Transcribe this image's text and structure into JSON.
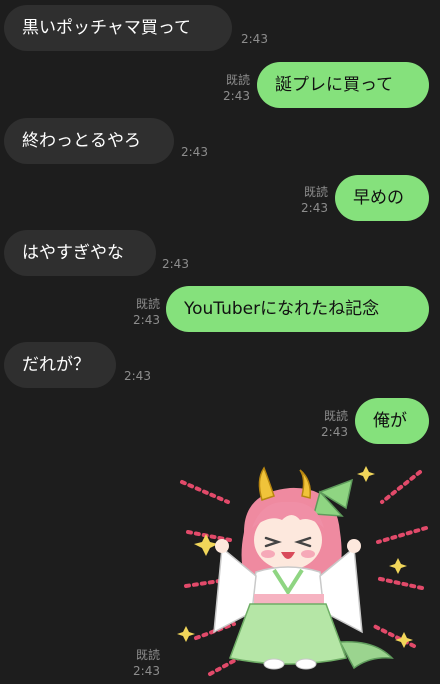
{
  "messages": [
    {
      "dir": "in",
      "text": "黒いポッチャマ買って",
      "time": "2:43"
    },
    {
      "dir": "out",
      "text": "誕プレに買って",
      "time": "2:43",
      "read": "既読"
    },
    {
      "dir": "in",
      "text": "終わっとるやろ",
      "time": "2:43"
    },
    {
      "dir": "out",
      "text": "早めの",
      "time": "2:43",
      "read": "既読"
    },
    {
      "dir": "in",
      "text": "はやすぎやな",
      "time": "2:43"
    },
    {
      "dir": "out",
      "text": "YouTuberになれたね記念",
      "time": "2:43",
      "read": "既読"
    },
    {
      "dir": "in",
      "text": "だれが？",
      "time": "2:43"
    },
    {
      "dir": "out",
      "text": "俺が",
      "time": "2:43",
      "read": "既読"
    },
    {
      "dir": "out",
      "type": "sticker",
      "sticker": "anime-oni-girl-sticker",
      "time": "2:43",
      "read": "既読"
    }
  ],
  "colors": {
    "background": "#1d1d1d",
    "incoming_bubble": "#2f2f2f",
    "outgoing_bubble": "#85e17c",
    "meta_text": "#8d8d8d"
  }
}
